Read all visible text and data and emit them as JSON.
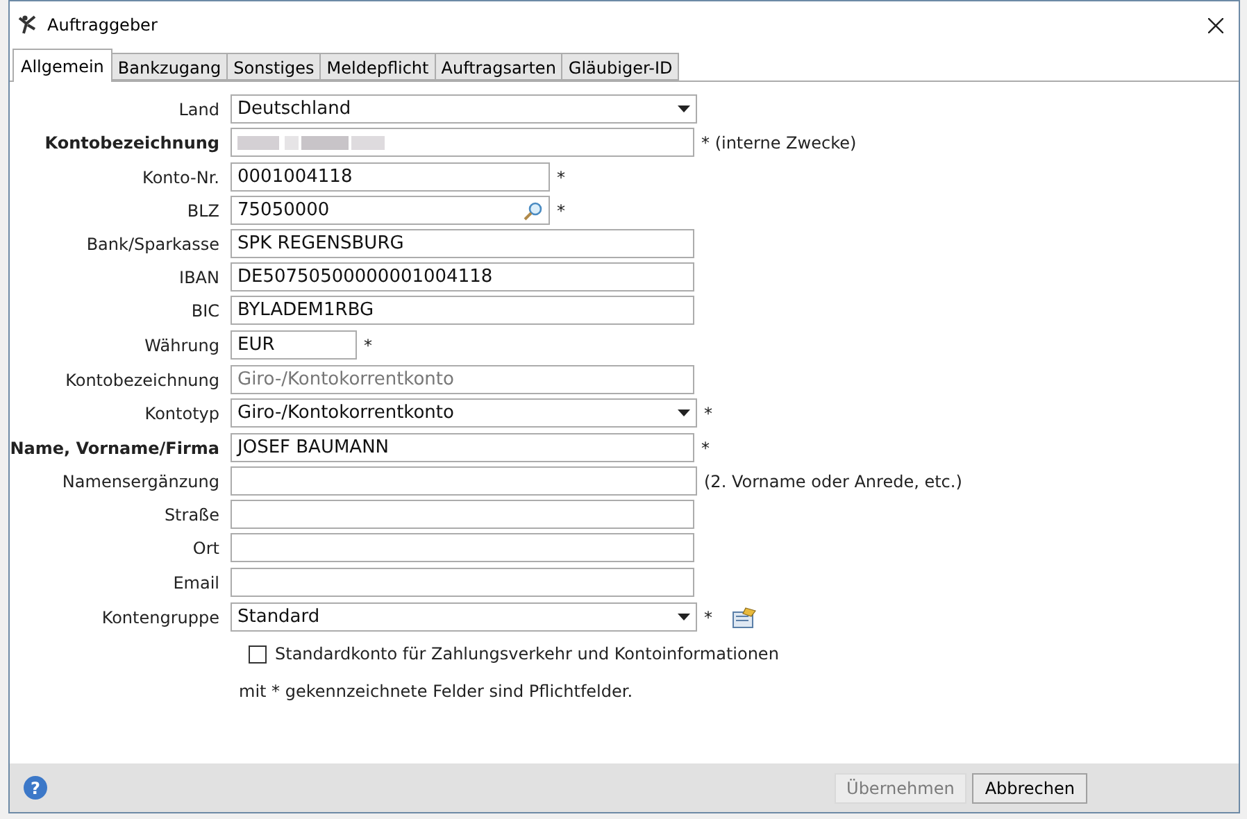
{
  "window": {
    "title": "Auftraggeber"
  },
  "tabs": [
    {
      "label": "Allgemein",
      "selected": true
    },
    {
      "label": "Bankzugang",
      "selected": false
    },
    {
      "label": "Sonstiges",
      "selected": false
    },
    {
      "label": "Meldepflicht",
      "selected": false
    },
    {
      "label": "Auftragsarten",
      "selected": false
    },
    {
      "label": "Gläubiger-ID",
      "selected": false
    }
  ],
  "groups": [
    [
      {
        "label": "Land",
        "bold": false,
        "kind": "select",
        "value": "Deutschland"
      },
      {
        "label": "Kontobezeichnung",
        "bold": true,
        "kind": "redacted",
        "suffix": "* (interne Zwecke)"
      }
    ],
    [
      {
        "label": "Konto-Nr.",
        "bold": false,
        "kind": "text-medium",
        "value": "0001004118",
        "suffix": "*"
      },
      {
        "label": "BLZ",
        "bold": false,
        "kind": "search",
        "value": "75050000",
        "suffix": "*"
      },
      {
        "label": "Bank/Sparkasse",
        "bold": false,
        "kind": "text",
        "value": "SPK REGENSBURG"
      },
      {
        "label": "IBAN",
        "bold": false,
        "kind": "text",
        "value": "DE50750500000001004118"
      },
      {
        "label": "BIC",
        "bold": false,
        "kind": "text",
        "value": "BYLADEM1RBG"
      }
    ],
    [
      {
        "label": "Währung",
        "bold": false,
        "kind": "text-short",
        "value": "EUR",
        "suffix": "*"
      }
    ],
    [
      {
        "label": "Kontobezeichnung",
        "bold": false,
        "kind": "text",
        "placeholder": "Giro-/Kontokorrentkonto"
      },
      {
        "label": "Kontotyp",
        "bold": false,
        "kind": "select",
        "value": "Giro-/Kontokorrentkonto",
        "suffix": "*"
      }
    ],
    [
      {
        "label": "Name, Vorname/Firma",
        "bold": true,
        "kind": "text",
        "value": "JOSEF BAUMANN",
        "suffix": "*"
      },
      {
        "label": "Namensergänzung",
        "bold": false,
        "kind": "text-wide",
        "suffix": "(2. Vorname oder Anrede, etc.)"
      },
      {
        "label": "Straße",
        "bold": false,
        "kind": "text"
      },
      {
        "label": "Ort",
        "bold": false,
        "kind": "text"
      }
    ],
    [
      {
        "label": "Email",
        "bold": false,
        "kind": "text"
      }
    ],
    [
      {
        "label": "Kontengruppe",
        "bold": false,
        "kind": "select",
        "value": "Standard",
        "suffix": "*",
        "edit_button": true
      }
    ]
  ],
  "checkbox": {
    "label": "Standardkonto für Zahlungsverkehr und Kontoinformationen",
    "checked": false
  },
  "footnote": "mit * gekennzeichnete Felder sind Pflichtfelder.",
  "help": "?",
  "buttons": [
    {
      "label": "Übernehmen",
      "disabled": true
    },
    {
      "label": "Abbrechen",
      "disabled": false
    }
  ]
}
